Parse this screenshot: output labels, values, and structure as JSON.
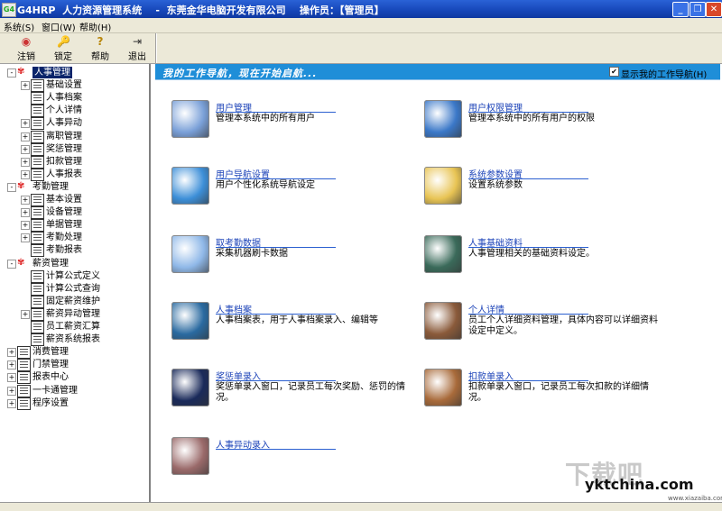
{
  "window": {
    "title": "G4HRP  人力资源管理系统    -  东莞金华电脑开发有限公司    操作员：【管理员】",
    "app_icon_text": "G4"
  },
  "menu": [
    "系统(S)",
    "窗口(W)",
    "帮助(H)"
  ],
  "toolbar": [
    {
      "label": "注销",
      "icon": "logout-icon"
    },
    {
      "label": "锁定",
      "icon": "lock-icon"
    },
    {
      "label": "帮助",
      "icon": "help-icon"
    },
    {
      "label": "退出",
      "icon": "exit-icon"
    }
  ],
  "tree": {
    "groups": [
      {
        "label": "人事管理",
        "expanded": true,
        "selected": true,
        "children": [
          {
            "label": "基础设置",
            "expandable": true
          },
          {
            "label": "人事档案",
            "expandable": false
          },
          {
            "label": "个人详情",
            "expandable": false
          },
          {
            "label": "人事异动",
            "expandable": true
          },
          {
            "label": "离职管理",
            "expandable": true
          },
          {
            "label": "奖惩管理",
            "expandable": true
          },
          {
            "label": "扣款管理",
            "expandable": true
          },
          {
            "label": "人事报表",
            "expandable": true
          }
        ]
      },
      {
        "label": "考勤管理",
        "expanded": true,
        "children": [
          {
            "label": "基本设置",
            "expandable": true
          },
          {
            "label": "设备管理",
            "expandable": true
          },
          {
            "label": "单据管理",
            "expandable": true
          },
          {
            "label": "考勤处理",
            "expandable": true
          },
          {
            "label": "考勤报表",
            "expandable": false
          }
        ]
      },
      {
        "label": "薪资管理",
        "expanded": true,
        "children": [
          {
            "label": "计算公式定义",
            "expandable": false
          },
          {
            "label": "计算公式查询",
            "expandable": false
          },
          {
            "label": "固定薪资维护",
            "expandable": false
          },
          {
            "label": "薪资异动管理",
            "expandable": true
          },
          {
            "label": "员工薪资汇算",
            "expandable": false
          },
          {
            "label": "薪资系统报表",
            "expandable": false
          }
        ]
      }
    ],
    "collapsed": [
      "消费管理",
      "门禁管理",
      "报表中心",
      "一卡通管理",
      "程序设置"
    ]
  },
  "main": {
    "header": "我的工作导航，现在开始启航...",
    "show_nav_label": "显示我的工作导航(H)",
    "show_nav_checked": true,
    "items": [
      {
        "title": "用户管理",
        "desc": "管理本系统中的所有用户",
        "icon": "user-management-icon",
        "color": "#7aa0d8"
      },
      {
        "title": "用户权限管理",
        "desc": "管理本系统中的所有用户的权限",
        "icon": "permission-gear-icon",
        "color": "#3b78c8"
      },
      {
        "title": "用户导航设置",
        "desc": "用户个性化系统导航设定",
        "icon": "blue-folder-icon",
        "color": "#3d8fd8"
      },
      {
        "title": "系统参数设置",
        "desc": "设置系统参数",
        "icon": "settings-folder-icon",
        "color": "#e8c454"
      },
      {
        "title": "取考勤数据",
        "desc": "采集机器刷卡数据",
        "icon": "calculator-icon",
        "color": "#8fb8e8"
      },
      {
        "title": "人事基础资料",
        "desc": "人事管理相关的基础资料设定。",
        "icon": "horse-image-icon",
        "color": "#3a6a5a"
      },
      {
        "title": "人事档案",
        "desc": "人事档案表，用于人事档案录入、编辑等",
        "icon": "archive-image-icon",
        "color": "#2a6aa0"
      },
      {
        "title": "个人详情",
        "desc": "员工个人详细资料管理，具体内容可以详细资料设定中定义。",
        "icon": "cube-image-icon",
        "color": "#8a5a3a"
      },
      {
        "title": "奖惩单录入",
        "desc": "奖惩单录入窗口，记录员工每次奖励、惩罚的情况。",
        "icon": "starburst-image-icon",
        "color": "#1a2a5a"
      },
      {
        "title": "扣款单录入",
        "desc": "扣款单录入窗口，记录员工每次扣款的详细情况。",
        "icon": "portrait-image-icon",
        "color": "#a86a3a"
      },
      {
        "title": "人事异动录入",
        "desc": "",
        "icon": "ruler-image-icon",
        "color": "#9a6a6a"
      }
    ]
  },
  "watermark": {
    "main": "下载吧",
    "site": "yktchina.com",
    "sub": "www.xiazaiba.com"
  }
}
